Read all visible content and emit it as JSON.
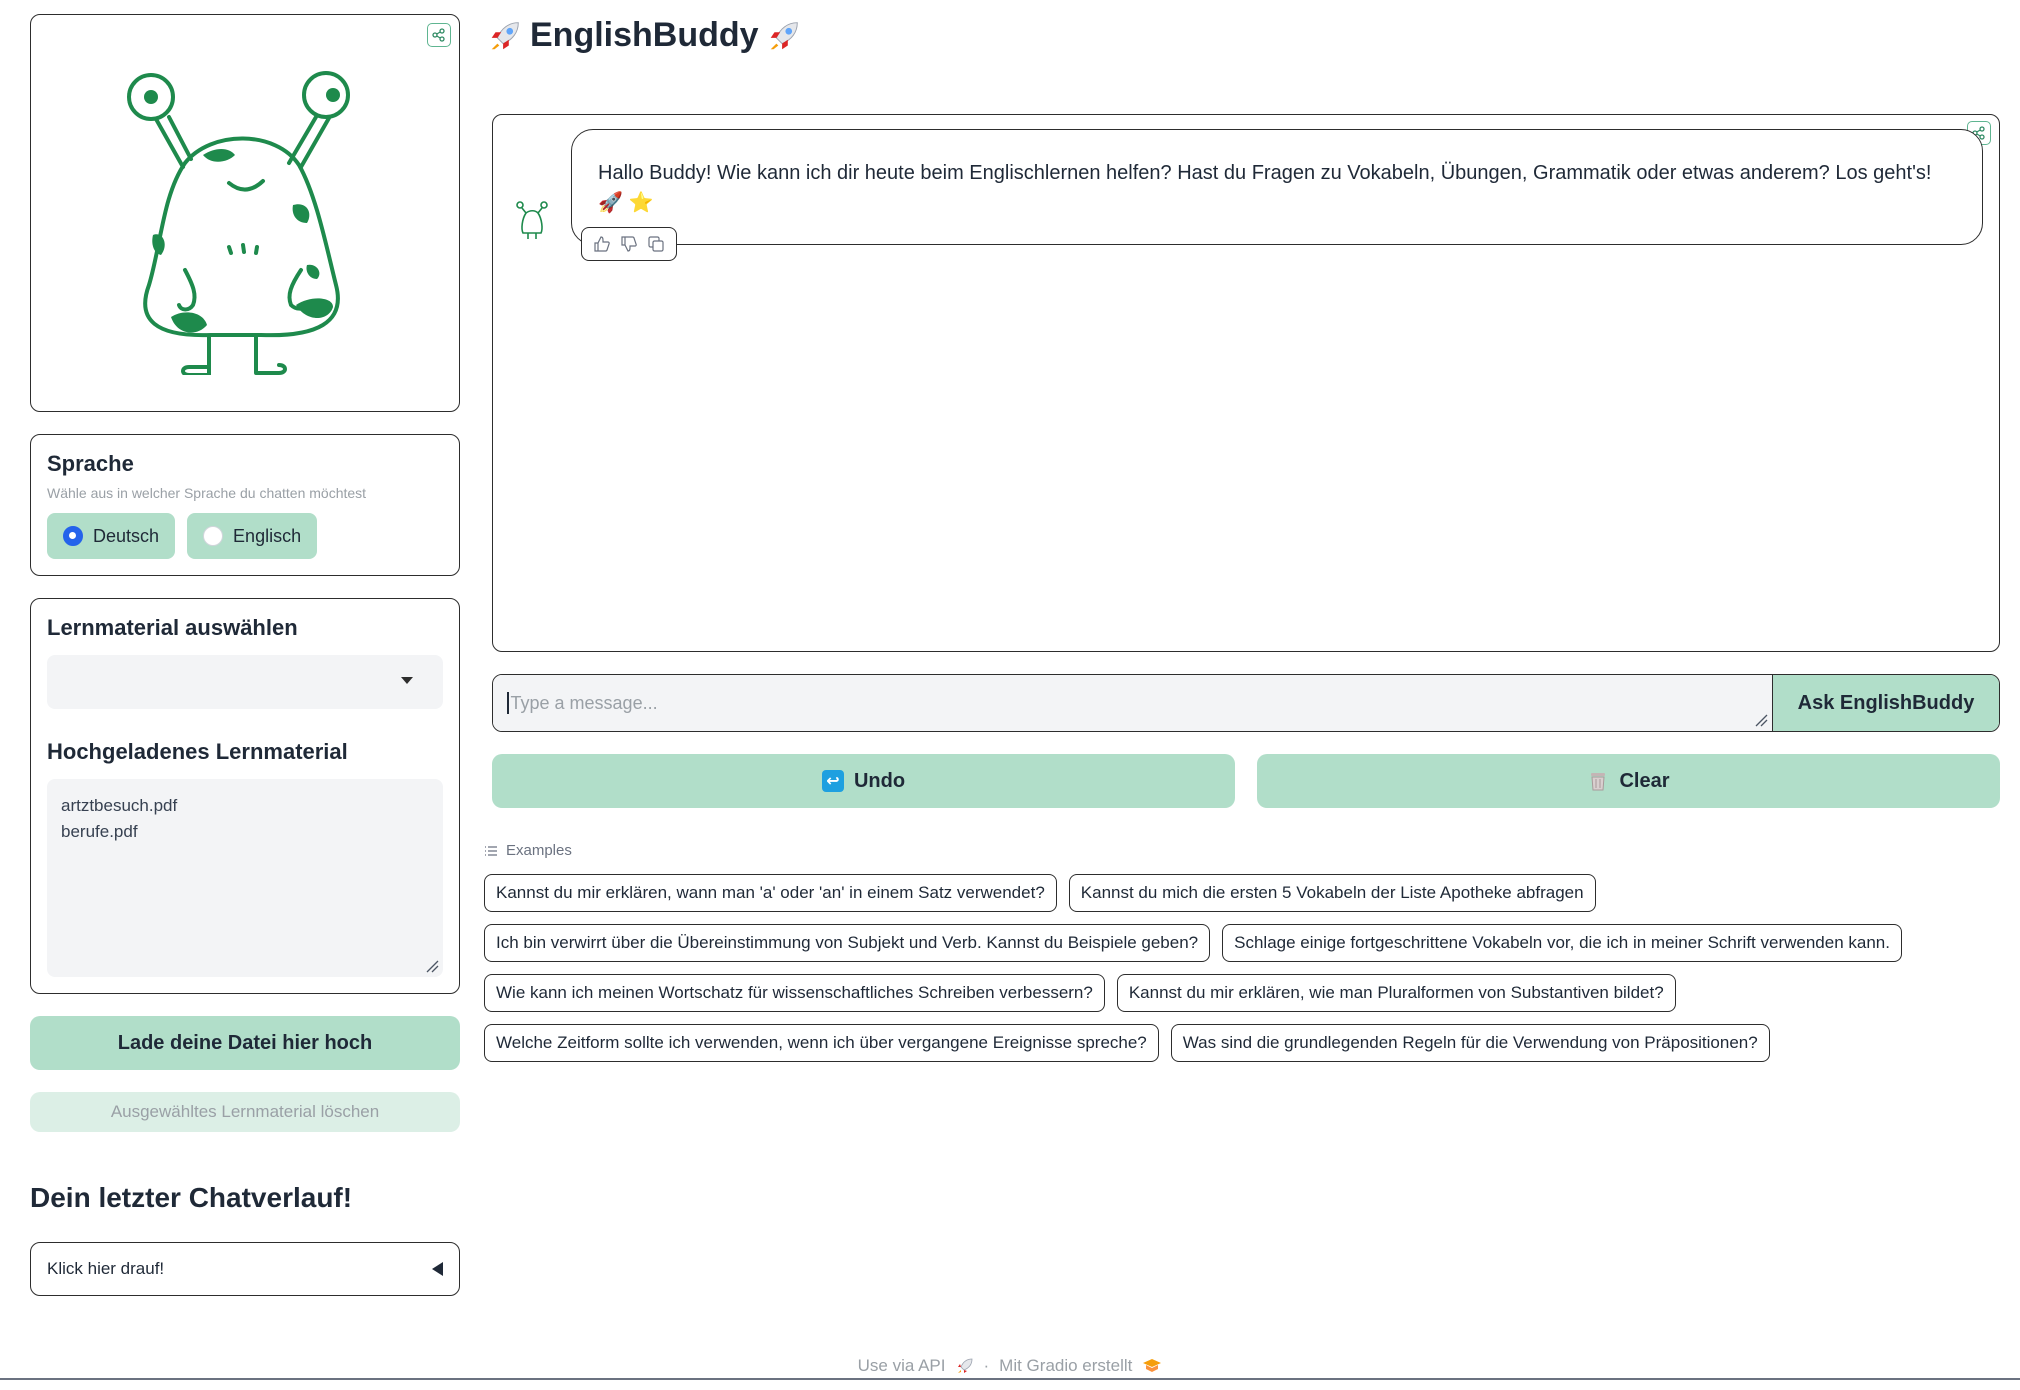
{
  "app": {
    "title": "EnglishBuddy"
  },
  "sidebar": {
    "language": {
      "title": "Sprache",
      "info": "Wähle aus in welcher Sprache du chatten möchtest",
      "options": [
        {
          "label": "Deutsch",
          "selected": true
        },
        {
          "label": "Englisch",
          "selected": false
        }
      ]
    },
    "material": {
      "select_title": "Lernmaterial auswählen",
      "selected_value": "",
      "uploaded_title": "Hochgeladenes Lernmaterial",
      "uploaded_files": [
        "artztbesuch.pdf",
        "berufe.pdf"
      ]
    },
    "upload_button": "Lade deine Datei hier hoch",
    "delete_button": "Ausgewähltes Lernmaterial löschen",
    "history_title": "Dein letzter Chatverlauf!",
    "accordion_label": "Klick hier drauf!"
  },
  "chat": {
    "messages": [
      {
        "role": "assistant",
        "text": "Hallo Buddy! Wie kann ich dir heute beim Englischlernen helfen? Hast du Fragen zu Vokabeln, Übungen, Grammatik oder etwas anderem? Los geht's! 🚀 ⭐"
      }
    ],
    "input_placeholder": "Type a message...",
    "input_value": "",
    "submit_label": "Ask EnglishBuddy",
    "undo_label": "Undo",
    "clear_label": "Clear"
  },
  "examples": {
    "label": "Examples",
    "items": [
      "Kannst du mir erklären, wann man 'a' oder 'an' in einem Satz verwendet?",
      "Kannst du mich die ersten 5 Vokabeln der Liste Apotheke abfragen",
      "Ich bin verwirrt über die Übereinstimmung von Subjekt und Verb. Kannst du Beispiele geben?",
      "Schlage einige fortgeschrittene Vokabeln vor, die ich in meiner Schrift verwenden kann.",
      "Wie kann ich meinen Wortschatz für wissenschaftliches Schreiben verbessern?",
      "Kannst du mir erklären, wie man Pluralformen von Substantiven bildet?",
      "Welche Zeitform sollte ich verwenden, wenn ich über vergangene Ereignisse spreche?",
      "Was sind die grundlegenden Regeln für die Verwendung von Präpositionen?"
    ]
  },
  "footer": {
    "api_label": "Use via API",
    "separator": "·",
    "gradio_label": "Mit Gradio erstellt"
  },
  "colors": {
    "accent": "#b1dec9",
    "accent_light": "#dcefe6",
    "mascot_green": "#1e8a4c",
    "radio_selected": "#2563eb",
    "border": "#2d2d2d"
  },
  "icons": {
    "share": "share-icon",
    "rocket": "rocket-icon",
    "star": "star-icon",
    "thumbs_up": "thumbs-up-icon",
    "thumbs_down": "thumbs-down-icon",
    "copy": "copy-icon",
    "undo": "undo-icon",
    "clear": "trash-icon",
    "list": "list-icon"
  }
}
